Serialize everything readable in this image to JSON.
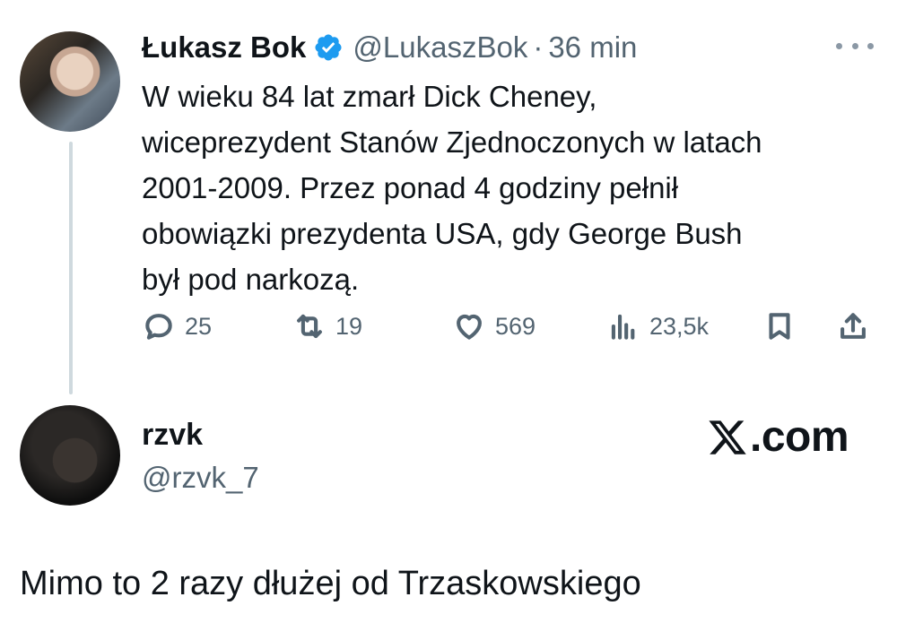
{
  "tweet1": {
    "name": "Łukasz Bok",
    "handle": "@LukaszBok",
    "separator": "·",
    "time": "36 min",
    "body_lines": [
      "W wieku 84 lat zmarł Dick Cheney,",
      "wiceprezydent Stanów Zjednoczonych w latach",
      "2001-2009. Przez ponad 4 godziny pełnił",
      "obowiązki prezydenta USA, gdy George Bush",
      "był pod narkozą."
    ],
    "actions": {
      "replies": "25",
      "reposts": "19",
      "likes": "569",
      "views": "23,5k"
    },
    "icons": {
      "verified": "verified-badge-icon",
      "more": "more-options-icon",
      "reply": "reply-icon",
      "repost": "repost-icon",
      "like": "like-icon",
      "views": "views-icon",
      "bookmark": "bookmark-icon",
      "share": "share-icon"
    }
  },
  "tweet2": {
    "name": "rzvk",
    "handle": "@rzvk_7",
    "body": "Mimo to 2 razy dłużej od Trzaskowskiego"
  },
  "watermark": {
    "text": ".com",
    "icon": "x-logo-icon"
  },
  "colors": {
    "text": "#0f1419",
    "secondary": "#536471",
    "verified": "#1d9bf0",
    "thread_line": "#cfd9de"
  }
}
